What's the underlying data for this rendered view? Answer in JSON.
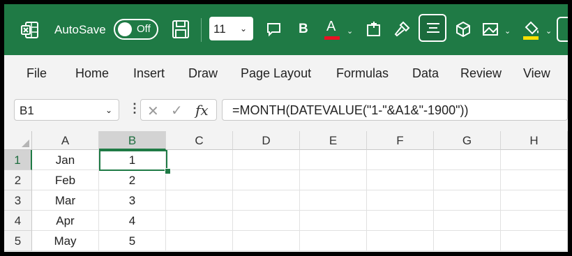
{
  "colors": {
    "brand_green": "#1f7a45",
    "font_color_bar": "#e81123",
    "highlight_bar": "#ffe100"
  },
  "titlebar": {
    "autosave_label": "AutoSave",
    "autosave_state": "Off",
    "font_size": "11",
    "icons": [
      "excel-icon",
      "save-icon",
      "comment-icon",
      "bold-icon",
      "font-color-icon",
      "insert-table-icon",
      "format-painter-icon",
      "align-center-icon",
      "3d-model-icon",
      "picture-icon",
      "fill-color-icon",
      "more-icon"
    ]
  },
  "ribbon": {
    "tabs": [
      "File",
      "Home",
      "Insert",
      "Draw",
      "Page Layout",
      "Formulas",
      "Data",
      "Review",
      "View"
    ]
  },
  "formula_bar": {
    "name_box": "B1",
    "formula": "=MONTH(DATEVALUE(\"1-\"&A1&\"-1900\"))"
  },
  "grid": {
    "columns": [
      "A",
      "B",
      "C",
      "D",
      "E",
      "F",
      "G",
      "H"
    ],
    "rows": [
      "1",
      "2",
      "3",
      "4",
      "5"
    ],
    "col_a": [
      "Jan",
      "Feb",
      "Mar",
      "Apr",
      "May"
    ],
    "col_b": [
      "1",
      "2",
      "3",
      "4",
      "5"
    ],
    "selected_cell": "B1"
  }
}
